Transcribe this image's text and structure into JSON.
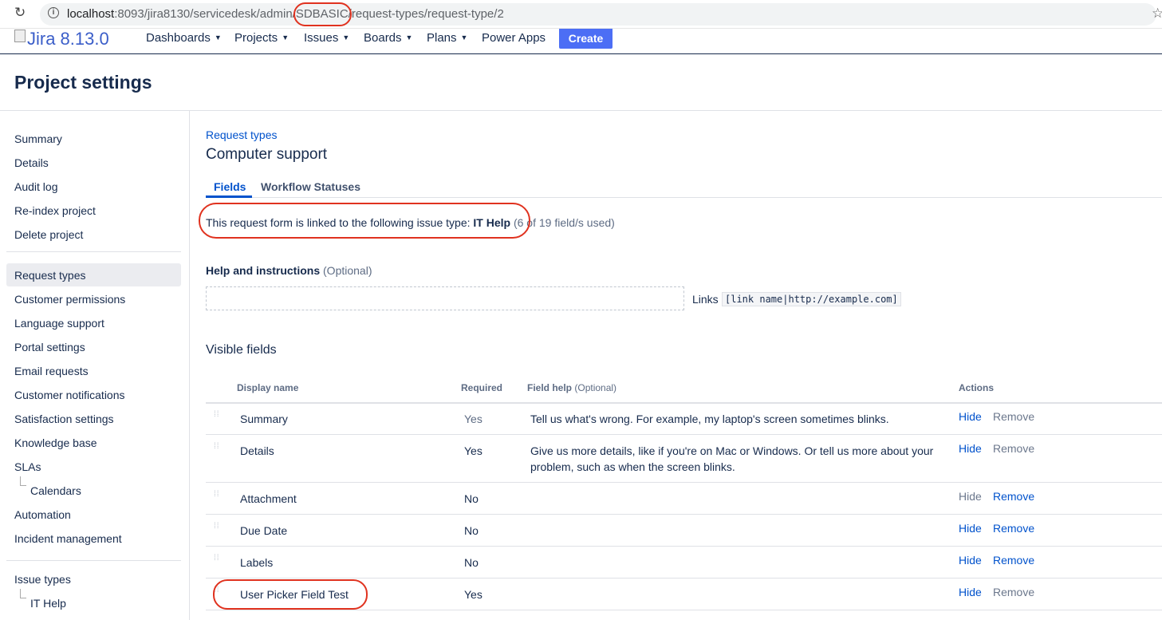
{
  "browser": {
    "url_host": "localhost",
    "url_path": ":8093/jira8130/servicedesk/admin/SDBASIC/request-types/request-type/2"
  },
  "header": {
    "logo_text": "Jira 8.13.0",
    "menus": [
      "Dashboards",
      "Projects",
      "Issues",
      "Boards",
      "Plans"
    ],
    "power_apps": "Power Apps",
    "create_label": "Create"
  },
  "page": {
    "title": "Project settings"
  },
  "sidebar": {
    "group1": [
      "Summary",
      "Details",
      "Audit log",
      "Re-index project",
      "Delete project"
    ],
    "group2": [
      "Request types",
      "Customer permissions",
      "Language support",
      "Portal settings",
      "Email requests",
      "Customer notifications",
      "Satisfaction settings",
      "Knowledge base",
      "SLAs",
      "Calendars",
      "Automation",
      "Incident management"
    ],
    "group3": [
      "Issue types",
      "IT Help"
    ]
  },
  "main": {
    "breadcrumb": "Request types",
    "title": "Computer support",
    "tabs": [
      "Fields",
      "Workflow Statuses"
    ],
    "linked_text": "This request form is linked to the following issue type: ",
    "linked_issue_type": "IT Help",
    "field_count": "(6 of 19 field/s used)",
    "help_label": "Help and instructions",
    "optional": "(Optional)",
    "links_label": "Links",
    "links_syntax": "[link name|http://example.com]",
    "visible_fields": "Visible fields"
  },
  "table": {
    "headers": {
      "display_name": "Display name",
      "required": "Required",
      "field_help": "Field help",
      "field_help_opt": "(Optional)",
      "actions": "Actions"
    },
    "rows": [
      {
        "name": "Summary",
        "required": "Yes",
        "help": "Tell us what's wrong. For example, my laptop's screen sometimes blinks.",
        "hide": "Hide",
        "remove": "Remove"
      },
      {
        "name": "Details",
        "required": "Yes",
        "help": "Give us more details, like if you're on Mac or Windows. Or tell us more about your problem, such as when the screen blinks.",
        "hide": "Hide",
        "remove": "Remove"
      },
      {
        "name": "Attachment",
        "required": "No",
        "help": "",
        "hide": "Hide",
        "remove": "Remove"
      },
      {
        "name": "Due Date",
        "required": "No",
        "help": "",
        "hide": "Hide",
        "remove": "Remove"
      },
      {
        "name": "Labels",
        "required": "No",
        "help": "",
        "hide": "Hide",
        "remove": "Remove"
      },
      {
        "name": "User Picker Field Test",
        "required": "Yes",
        "help": "",
        "hide": "Hide",
        "remove": "Remove"
      }
    ]
  },
  "colors": {
    "annotation": "#e0321f",
    "link": "#0052cc",
    "create": "#4c6ef5"
  }
}
